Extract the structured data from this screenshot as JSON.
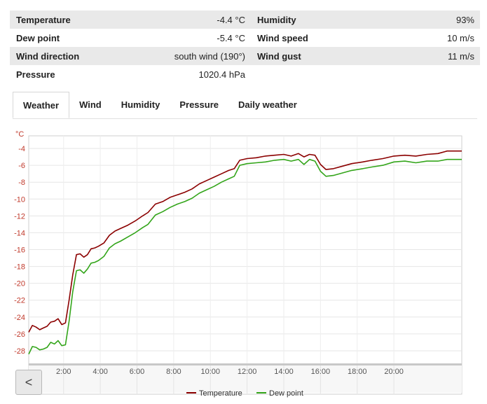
{
  "stats": {
    "rows": [
      {
        "l_label": "Temperature",
        "l_value": "-4.4 °C",
        "r_label": "Humidity",
        "r_value": "93%"
      },
      {
        "l_label": "Dew point",
        "l_value": "-5.4 °C",
        "r_label": "Wind speed",
        "r_value": "10 m/s"
      },
      {
        "l_label": "Wind direction",
        "l_value": "south wind (190°)",
        "r_label": "Wind gust",
        "r_value": "11 m/s"
      },
      {
        "l_label": "Pressure",
        "l_value": "1020.4 hPa",
        "r_label": "",
        "r_value": ""
      }
    ]
  },
  "tabs": [
    {
      "label": "Weather",
      "active": true
    },
    {
      "label": "Wind",
      "active": false
    },
    {
      "label": "Humidity",
      "active": false
    },
    {
      "label": "Pressure",
      "active": false
    },
    {
      "label": "Daily weather",
      "active": false
    }
  ],
  "back_button": {
    "label": "<"
  },
  "chart_data": {
    "type": "line",
    "ylabel": "°C",
    "ylim": [
      -29.5,
      -2.5
    ],
    "yticks": [
      -4,
      -6,
      -8,
      -10,
      -12,
      -14,
      -16,
      -18,
      -20,
      -22,
      -24,
      -26,
      -28
    ],
    "xlim": [
      0.1,
      23.7
    ],
    "xticks": [
      {
        "value": 2,
        "label": "2:00"
      },
      {
        "value": 4,
        "label": "4:00"
      },
      {
        "value": 6,
        "label": "6:00"
      },
      {
        "value": 8,
        "label": "8:00"
      },
      {
        "value": 10,
        "label": "10:00"
      },
      {
        "value": 12,
        "label": "12:00"
      },
      {
        "value": 14,
        "label": "14:00"
      },
      {
        "value": 16,
        "label": "16:00"
      },
      {
        "value": 18,
        "label": "18:00"
      },
      {
        "value": 20,
        "label": "20:00"
      }
    ],
    "grid": true,
    "legend": "bottom-center",
    "series": [
      {
        "name": "Temperature",
        "color": "#8b0000",
        "points": [
          [
            0.1,
            -25.8
          ],
          [
            0.3,
            -25.0
          ],
          [
            0.5,
            -25.2
          ],
          [
            0.7,
            -25.5
          ],
          [
            0.9,
            -25.3
          ],
          [
            1.1,
            -25.1
          ],
          [
            1.3,
            -24.6
          ],
          [
            1.5,
            -24.5
          ],
          [
            1.7,
            -24.2
          ],
          [
            1.9,
            -24.9
          ],
          [
            2.1,
            -24.7
          ],
          [
            2.3,
            -22.0
          ],
          [
            2.5,
            -19.0
          ],
          [
            2.7,
            -16.6
          ],
          [
            2.9,
            -16.5
          ],
          [
            3.1,
            -16.9
          ],
          [
            3.3,
            -16.6
          ],
          [
            3.5,
            -15.9
          ],
          [
            3.7,
            -15.8
          ],
          [
            3.9,
            -15.6
          ],
          [
            4.2,
            -15.2
          ],
          [
            4.5,
            -14.3
          ],
          [
            4.8,
            -13.8
          ],
          [
            5.1,
            -13.5
          ],
          [
            5.5,
            -13.1
          ],
          [
            5.9,
            -12.6
          ],
          [
            6.3,
            -12.0
          ],
          [
            6.6,
            -11.6
          ],
          [
            7.0,
            -10.6
          ],
          [
            7.4,
            -10.3
          ],
          [
            7.8,
            -9.8
          ],
          [
            8.2,
            -9.5
          ],
          [
            8.6,
            -9.2
          ],
          [
            9.0,
            -8.8
          ],
          [
            9.4,
            -8.2
          ],
          [
            9.8,
            -7.8
          ],
          [
            10.2,
            -7.4
          ],
          [
            10.6,
            -7.0
          ],
          [
            11.0,
            -6.6
          ],
          [
            11.3,
            -6.4
          ],
          [
            11.6,
            -5.4
          ],
          [
            12.0,
            -5.2
          ],
          [
            12.5,
            -5.1
          ],
          [
            13.0,
            -4.9
          ],
          [
            13.5,
            -4.8
          ],
          [
            14.0,
            -4.7
          ],
          [
            14.4,
            -4.9
          ],
          [
            14.8,
            -4.6
          ],
          [
            15.1,
            -5.0
          ],
          [
            15.4,
            -4.7
          ],
          [
            15.7,
            -4.8
          ],
          [
            16.0,
            -5.9
          ],
          [
            16.3,
            -6.5
          ],
          [
            16.7,
            -6.4
          ],
          [
            17.2,
            -6.1
          ],
          [
            17.7,
            -5.8
          ],
          [
            18.3,
            -5.6
          ],
          [
            18.8,
            -5.4
          ],
          [
            19.4,
            -5.2
          ],
          [
            20.0,
            -4.9
          ],
          [
            20.6,
            -4.8
          ],
          [
            21.2,
            -4.9
          ],
          [
            21.8,
            -4.7
          ],
          [
            22.4,
            -4.6
          ],
          [
            22.9,
            -4.3
          ],
          [
            23.3,
            -4.3
          ],
          [
            23.7,
            -4.3
          ]
        ]
      },
      {
        "name": "Dew point",
        "color": "#33a51a",
        "points": [
          [
            0.1,
            -28.4
          ],
          [
            0.3,
            -27.5
          ],
          [
            0.5,
            -27.6
          ],
          [
            0.7,
            -27.9
          ],
          [
            0.9,
            -27.8
          ],
          [
            1.1,
            -27.6
          ],
          [
            1.3,
            -27.0
          ],
          [
            1.5,
            -27.2
          ],
          [
            1.7,
            -26.8
          ],
          [
            1.9,
            -27.4
          ],
          [
            2.1,
            -27.3
          ],
          [
            2.3,
            -24.5
          ],
          [
            2.5,
            -21.0
          ],
          [
            2.7,
            -18.5
          ],
          [
            2.9,
            -18.4
          ],
          [
            3.1,
            -18.8
          ],
          [
            3.3,
            -18.3
          ],
          [
            3.5,
            -17.6
          ],
          [
            3.7,
            -17.5
          ],
          [
            3.9,
            -17.3
          ],
          [
            4.2,
            -16.8
          ],
          [
            4.5,
            -15.8
          ],
          [
            4.8,
            -15.3
          ],
          [
            5.1,
            -15.0
          ],
          [
            5.5,
            -14.5
          ],
          [
            5.9,
            -14.0
          ],
          [
            6.3,
            -13.4
          ],
          [
            6.6,
            -13.0
          ],
          [
            7.0,
            -11.9
          ],
          [
            7.4,
            -11.5
          ],
          [
            7.8,
            -11.0
          ],
          [
            8.2,
            -10.6
          ],
          [
            8.6,
            -10.3
          ],
          [
            9.0,
            -9.9
          ],
          [
            9.4,
            -9.3
          ],
          [
            9.8,
            -8.9
          ],
          [
            10.2,
            -8.5
          ],
          [
            10.6,
            -8.0
          ],
          [
            11.0,
            -7.6
          ],
          [
            11.3,
            -7.3
          ],
          [
            11.6,
            -6.0
          ],
          [
            12.0,
            -5.8
          ],
          [
            12.5,
            -5.7
          ],
          [
            13.0,
            -5.6
          ],
          [
            13.5,
            -5.4
          ],
          [
            14.0,
            -5.3
          ],
          [
            14.4,
            -5.5
          ],
          [
            14.8,
            -5.3
          ],
          [
            15.1,
            -5.9
          ],
          [
            15.4,
            -5.3
          ],
          [
            15.7,
            -5.5
          ],
          [
            16.0,
            -6.7
          ],
          [
            16.3,
            -7.3
          ],
          [
            16.7,
            -7.2
          ],
          [
            17.2,
            -6.9
          ],
          [
            17.7,
            -6.6
          ],
          [
            18.3,
            -6.4
          ],
          [
            18.8,
            -6.2
          ],
          [
            19.4,
            -6.0
          ],
          [
            20.0,
            -5.6
          ],
          [
            20.6,
            -5.5
          ],
          [
            21.2,
            -5.7
          ],
          [
            21.8,
            -5.5
          ],
          [
            22.4,
            -5.5
          ],
          [
            22.9,
            -5.3
          ],
          [
            23.3,
            -5.3
          ],
          [
            23.7,
            -5.3
          ]
        ]
      }
    ]
  }
}
